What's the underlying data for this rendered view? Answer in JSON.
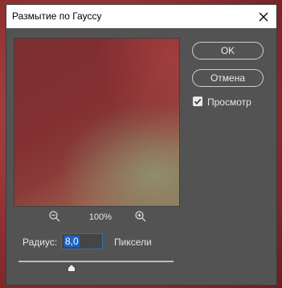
{
  "dialog": {
    "title": "Размытие по Гауссу",
    "close_icon": "close-icon"
  },
  "buttons": {
    "ok_label": "OK",
    "cancel_label": "Отмена"
  },
  "preview_option": {
    "label": "Просмотр",
    "checked": true
  },
  "zoom": {
    "percent": "100%",
    "zoom_out_icon": "zoom-out-icon",
    "zoom_in_icon": "zoom-in-icon"
  },
  "radius": {
    "label": "Радиус:",
    "value": "8,0",
    "units": "Пиксели",
    "slider_level": 0.34
  },
  "colors": {
    "dialog_bg": "#535353",
    "accent": "#1b63c2",
    "background_red": "#8e2f31"
  }
}
